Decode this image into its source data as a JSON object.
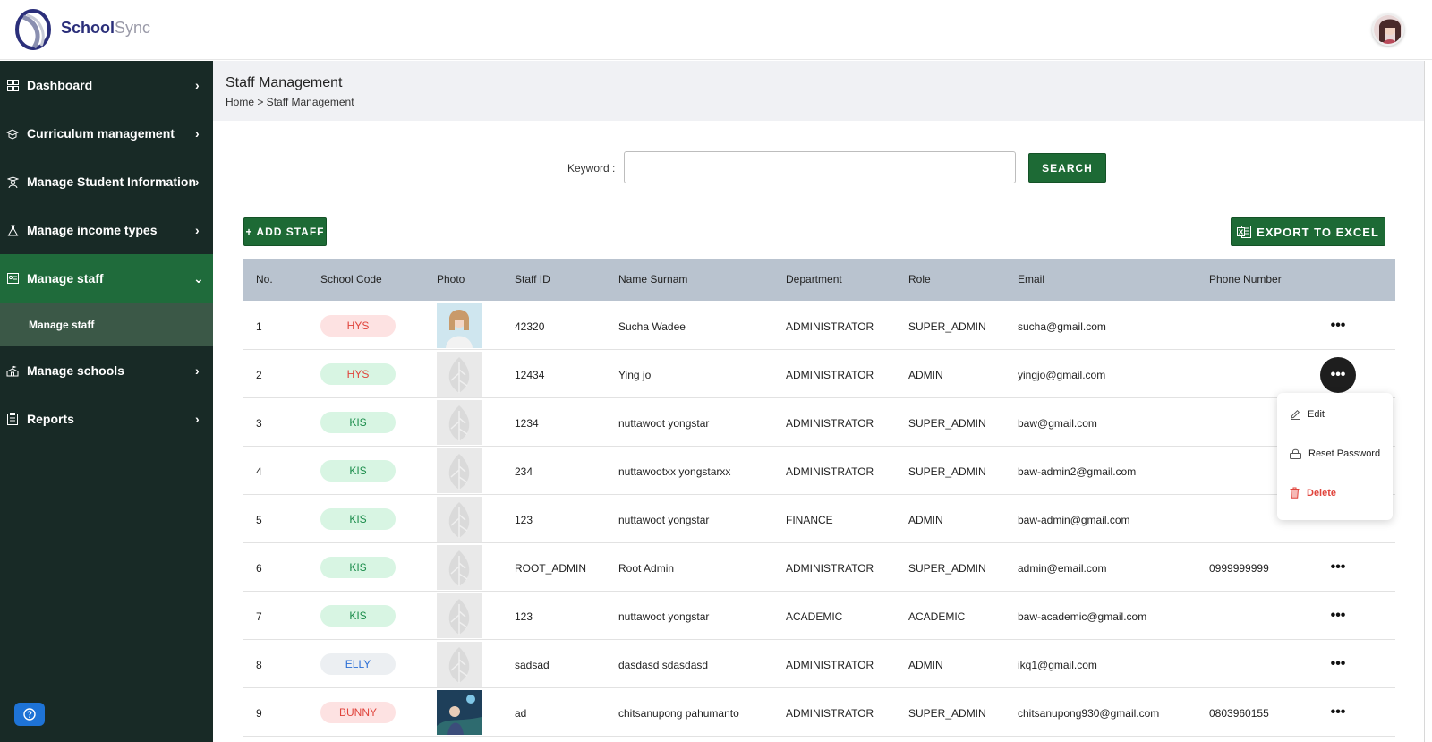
{
  "header": {
    "brand_part1": "School",
    "brand_part2": "Sync"
  },
  "sidebar": {
    "items": [
      {
        "label": "Dashboard",
        "icon": "grid-icon"
      },
      {
        "label": "Curriculum management",
        "icon": "graduation-cap-icon"
      },
      {
        "label": "Manage Student Information",
        "icon": "student-icon"
      },
      {
        "label": "Manage income types",
        "icon": "flask-icon"
      },
      {
        "label": "Manage staff",
        "icon": "staff-card-icon"
      },
      {
        "label": "Manage schools",
        "icon": "school-icon"
      },
      {
        "label": "Reports",
        "icon": "clipboard-icon"
      }
    ],
    "sub_item": "Manage staff"
  },
  "page": {
    "title": "Staff Management",
    "breadcrumb": "Home > Staff Management"
  },
  "search": {
    "label": "Keyword :",
    "value": "",
    "placeholder": "",
    "button": "SEARCH"
  },
  "actions": {
    "add_staff": "+ ADD STAFF",
    "export": "EXPORT TO EXCEL"
  },
  "table": {
    "headers": [
      "No.",
      "School Code",
      "Photo",
      "Staff ID",
      "Name Surnam",
      "Department",
      "Role",
      "Email",
      "Phone Number"
    ],
    "rows": [
      {
        "no": "1",
        "school": "HYS",
        "staff_id": "42320",
        "name": "Sucha Wadee",
        "dept": "ADMINISTRATOR",
        "role": "SUPER_ADMIN",
        "email": "sucha@gmail.com",
        "phone": ""
      },
      {
        "no": "2",
        "school": "HYS",
        "staff_id": "12434",
        "name": "Ying jo",
        "dept": "ADMINISTRATOR",
        "role": "ADMIN",
        "email": "yingjo@gmail.com",
        "phone": ""
      },
      {
        "no": "3",
        "school": "KIS",
        "staff_id": "1234",
        "name": "nuttawoot yongstar",
        "dept": "ADMINISTRATOR",
        "role": "SUPER_ADMIN",
        "email": "baw@gmail.com",
        "phone": ""
      },
      {
        "no": "4",
        "school": "KIS",
        "staff_id": "234",
        "name": "nuttawootxx yongstarxx",
        "dept": "ADMINISTRATOR",
        "role": "SUPER_ADMIN",
        "email": "baw-admin2@gmail.com",
        "phone": ""
      },
      {
        "no": "5",
        "school": "KIS",
        "staff_id": "123",
        "name": "nuttawoot yongstar",
        "dept": "FINANCE",
        "role": "ADMIN",
        "email": "baw-admin@gmail.com",
        "phone": ""
      },
      {
        "no": "6",
        "school": "KIS",
        "staff_id": "ROOT_ADMIN",
        "name": "Root Admin",
        "dept": "ADMINISTRATOR",
        "role": "SUPER_ADMIN",
        "email": "admin@email.com",
        "phone": "0999999999"
      },
      {
        "no": "7",
        "school": "KIS",
        "staff_id": "123",
        "name": "nuttawoot yongstar",
        "dept": "ACADEMIC",
        "role": "ACADEMIC",
        "email": "baw-academic@gmail.com",
        "phone": ""
      },
      {
        "no": "8",
        "school": "ELLY",
        "staff_id": "sadsad",
        "name": "dasdasd sdasdasd",
        "dept": "ADMINISTRATOR",
        "role": "ADMIN",
        "email": "ikq1@gmail.com",
        "phone": ""
      },
      {
        "no": "9",
        "school": "BUNNY",
        "staff_id": "ad",
        "name": "chitsanupong pahumanto",
        "dept": "ADMINISTRATOR",
        "role": "SUPER_ADMIN",
        "email": "chitsanupong930@gmail.com",
        "phone": "0803960155"
      }
    ],
    "more_label": "•••"
  },
  "row_menu": {
    "edit": "Edit",
    "reset": "Reset Password",
    "delete": "Delete"
  },
  "colors": {
    "sidebar_bg": "#182a26",
    "accent_green": "#1d6a35",
    "active_nav": "#1f6b3b",
    "table_header": "#b9c3cf",
    "danger": "#e0443c"
  }
}
